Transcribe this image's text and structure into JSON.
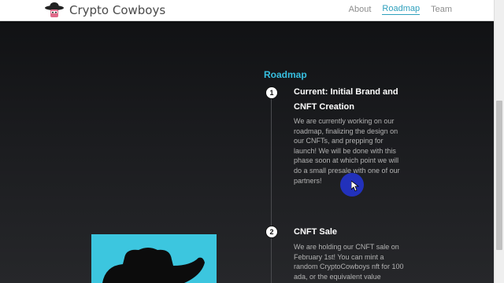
{
  "brand": {
    "name": "Crypto Cowboys",
    "logo_icon": "cowboy-hat-logo-icon"
  },
  "nav": {
    "links": [
      {
        "label": "About",
        "active": false
      },
      {
        "label": "Roadmap",
        "active": true
      },
      {
        "label": "Team",
        "active": false
      }
    ]
  },
  "roadmap": {
    "title": "Roadmap",
    "steps": [
      {
        "number": "1",
        "title": "Current: Initial Brand and CNFT Creation",
        "body": "We are currently working on our roadmap, finalizing the design on our CNFTs, and prepping for launch! We will be done with this phase soon at which point we will do a small presale with one of our partners!"
      },
      {
        "number": "2",
        "title": "CNFT Sale",
        "body": "We are holding our CNFT sale on February 1st! You can mint a random CryptoCowboys nft for 100 ada, or the equivalent value"
      }
    ]
  },
  "colors": {
    "accent": "#37bfe0",
    "art_background": "#3cc6df",
    "background": "#1a1b1e"
  }
}
